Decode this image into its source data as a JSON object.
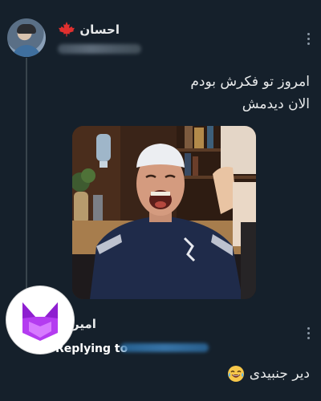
{
  "tweet": {
    "author_name": "احسان",
    "text_lines": [
      "امروز تو فکرش بودم",
      "الان دیدمش"
    ]
  },
  "reply": {
    "author_name": "امیر",
    "replying_to_label": "Replying to",
    "text": "دیر جنبیدی"
  },
  "icons": {
    "flag": "canada-flag-icon",
    "emoji": "face-with-tears-of-joy-icon",
    "more": "more-options-icon"
  },
  "colors": {
    "background": "#15202b",
    "text": "#e7e9ea",
    "muted": "#8b98a5",
    "avatar_accent": "#b43cf0"
  }
}
